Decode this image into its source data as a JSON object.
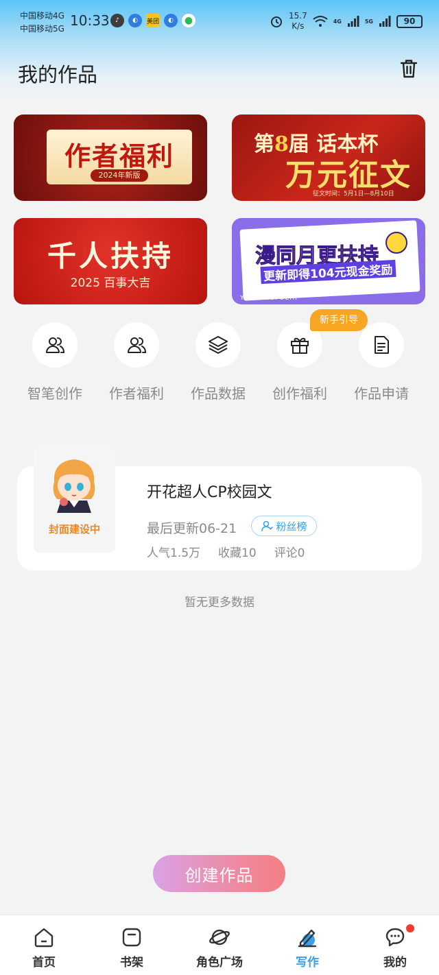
{
  "status_bar": {
    "carrier_1": "中国移动4G",
    "carrier_2": "中国移动5G",
    "time": "10:33",
    "app_icons": [
      {
        "name": "tiktok-icon",
        "color": "#3d3d3d"
      },
      {
        "name": "browser-icon",
        "color": "#2f7de1"
      },
      {
        "name": "meituan-icon",
        "color": "#f8c513",
        "label": "美团"
      },
      {
        "name": "browser-icon",
        "color": "#2f7de1"
      },
      {
        "name": "wechat-icon",
        "color": "#2bbb58"
      }
    ],
    "speed_value": "15.7",
    "speed_unit": "K/s",
    "net_1": "4G",
    "net_2": "5G",
    "battery": "90"
  },
  "header": {
    "title": "我的作品",
    "trash_icon": "trash-icon"
  },
  "banners": [
    {
      "id": "author-benefits-2024",
      "title": "作者福利",
      "subtitle": "2024年新版"
    },
    {
      "id": "huaben-cup",
      "line1_prefix": "第",
      "line1_num": "8",
      "line1_suffix": "届",
      "line1_tail": "话本杯",
      "line2": "万元征文",
      "line3": "征文时间：5月1日—8月10日"
    },
    {
      "id": "thousand-support",
      "title": "千人扶持",
      "subtitle": "2025 百事大吉"
    },
    {
      "id": "comic-monthly",
      "title": "漫同月更扶持",
      "subtitle": "更新即得104元现金奖励",
      "footer": "YUEGENGFUCHI"
    }
  ],
  "quick_actions": [
    {
      "label": "智笔创作",
      "icon": "users-icon"
    },
    {
      "label": "作者福利",
      "icon": "users-icon"
    },
    {
      "label": "作品数据",
      "icon": "layers-icon"
    },
    {
      "label": "创作福利",
      "icon": "gift-icon"
    },
    {
      "label": "作品申请",
      "icon": "document-icon"
    }
  ],
  "tip_badge": "新手引导",
  "work": {
    "cover_text": "封面建设中",
    "title": "开花超人CP校园文",
    "update": "最后更新06-21",
    "fan_button": "粉丝榜",
    "popularity": "人气1.5万",
    "favorites": "收藏10",
    "comments": "评论0"
  },
  "no_more": "暂无更多数据",
  "create_button": "创建作品",
  "nav": [
    {
      "label": "首页",
      "icon": "home-icon"
    },
    {
      "label": "书架",
      "icon": "bookshelf-icon"
    },
    {
      "label": "角色广场",
      "icon": "planet-icon"
    },
    {
      "label": "写作",
      "icon": "write-icon",
      "active": true
    },
    {
      "label": "我的",
      "icon": "chat-icon",
      "badge": true
    }
  ],
  "colors": {
    "accent": "#3a9ee8",
    "tip": "#f6a623",
    "badge": "#f03b2e"
  }
}
